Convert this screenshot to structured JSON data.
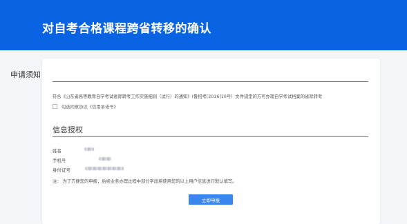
{
  "header": {
    "title": "对自考合格课程跨省转移的确认"
  },
  "notice": {
    "title": "申请须知",
    "text": "符合《山东省高等教育自学考试省际转考工作实施细则（试行）的通知》(鲁招考[2016]10号）文件规定的方可办理自学考试档案的省际转考",
    "checkbox_checked": false,
    "checkbox_label": "勾选同意协议《信用承诺书》"
  },
  "info": {
    "title": "信息授权",
    "fields": [
      {
        "label": "姓名",
        "value_masked": true
      },
      {
        "label": "手机号",
        "value_masked": true
      },
      {
        "label": "身份证号",
        "value_masked": true
      }
    ],
    "note": "注：  为了方便您的申报，后续业务办理过程中部分字段将使用您的以上用户信息进行默认填写。"
  },
  "actions": {
    "submit_label": "立即申报"
  },
  "colors": {
    "banner": "#0a63e2",
    "button": "#3a86ec",
    "page_bg": "#f3f5f8"
  }
}
